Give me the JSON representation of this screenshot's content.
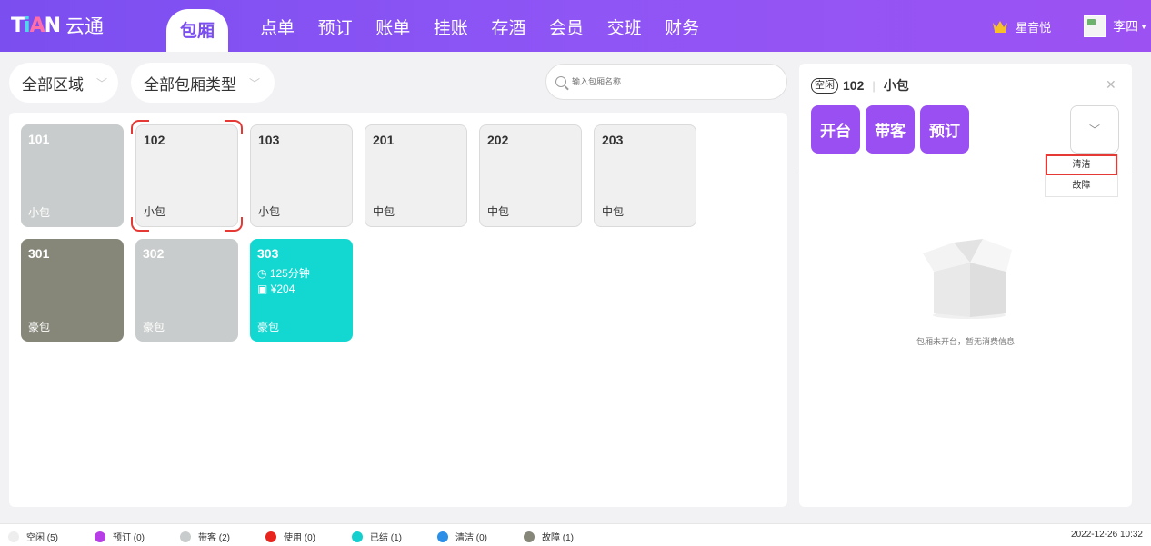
{
  "header": {
    "logo_text": "云通",
    "logo_mark": [
      "T",
      "i",
      "A",
      "N"
    ],
    "active_tab": "包厢",
    "nav_items": [
      "点单",
      "预订",
      "账单",
      "挂账",
      "存酒",
      "会员",
      "交班",
      "财务"
    ],
    "store_name": "星音悦",
    "user_name": "李四",
    "colors": {
      "gradient_start": "#7b4ef0",
      "gradient_end": "#9c52f3"
    }
  },
  "filters": {
    "area": "全部区域",
    "room_type": "全部包厢类型",
    "search_placeholder": "输入包厢名称"
  },
  "rooms": [
    {
      "number": "101",
      "type": "小包",
      "status": "booked-guest"
    },
    {
      "number": "102",
      "type": "小包",
      "status": "idle",
      "selected": true
    },
    {
      "number": "103",
      "type": "小包",
      "status": "idle"
    },
    {
      "number": "201",
      "type": "中包",
      "status": "idle"
    },
    {
      "number": "202",
      "type": "中包",
      "status": "idle"
    },
    {
      "number": "203",
      "type": "中包",
      "status": "idle"
    },
    {
      "number": "301",
      "type": "豪包",
      "status": "fault"
    },
    {
      "number": "302",
      "type": "豪包",
      "status": "booked-guest"
    },
    {
      "number": "303",
      "type": "豪包",
      "status": "settled",
      "duration": "125分钟",
      "amount": "¥204"
    }
  ],
  "detail": {
    "status": "空闲",
    "room_number": "102",
    "separator": "|",
    "room_type": "小包",
    "actions": [
      "开台",
      "带客",
      "预订"
    ],
    "menu_items": [
      "清洁",
      "故障"
    ],
    "empty_text": "包厢未开台，暂无消费信息"
  },
  "legend": [
    {
      "label": "空闲 (5)",
      "color": "#eeeeee"
    },
    {
      "label": "预订 (0)",
      "color": "#b73ee6"
    },
    {
      "label": "带客 (2)",
      "color": "#c9cccc"
    },
    {
      "label": "使用 (0)",
      "color": "#e8241e"
    },
    {
      "label": "已结 (1)",
      "color": "#13d0cf"
    },
    {
      "label": "清洁 (0)",
      "color": "#2b8fe8"
    },
    {
      "label": "故障 (1)",
      "color": "#868679"
    }
  ],
  "datetime": "2022-12-26 10:32"
}
